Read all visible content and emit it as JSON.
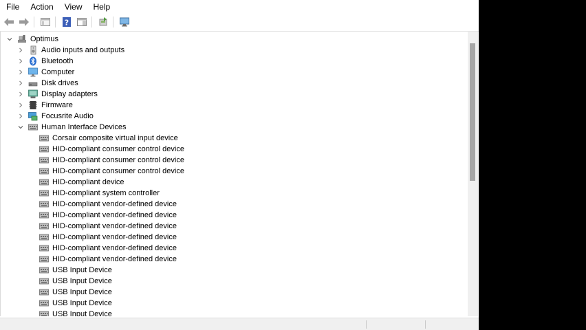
{
  "menu": {
    "file": "File",
    "action": "Action",
    "view": "View",
    "help": "Help"
  },
  "toolbar": {
    "icons": [
      "back-arrow-icon",
      "forward-arrow-icon",
      "properties-icon",
      "help-icon",
      "action-pane-icon",
      "update-driver-icon",
      "scan-hardware-icon"
    ]
  },
  "tree": {
    "root": "Optimus",
    "categories": [
      "Audio inputs and outputs",
      "Bluetooth",
      "Computer",
      "Disk drives",
      "Display adapters",
      "Firmware",
      "Focusrite Audio",
      "Human Interface Devices"
    ],
    "hid_devices": [
      "Corsair composite virtual input device",
      "HID-compliant consumer control device",
      "HID-compliant consumer control device",
      "HID-compliant consumer control device",
      "HID-compliant device",
      "HID-compliant system controller",
      "HID-compliant vendor-defined device",
      "HID-compliant vendor-defined device",
      "HID-compliant vendor-defined device",
      "HID-compliant vendor-defined device",
      "HID-compliant vendor-defined device",
      "HID-compliant vendor-defined device",
      "USB Input Device",
      "USB Input Device",
      "USB Input Device",
      "USB Input Device",
      "USB Input Device"
    ]
  },
  "colors": {
    "window_bg": "#ffffff",
    "outer_bg": "#000000",
    "scroll_thumb": "#a6a6a6",
    "text": "#000000"
  }
}
